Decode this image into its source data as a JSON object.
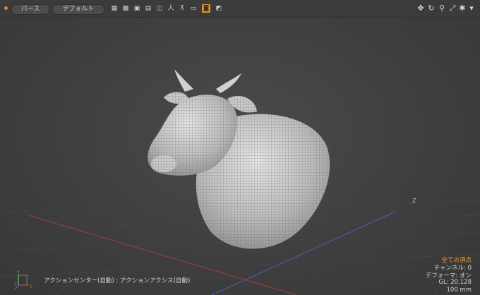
{
  "toolbar": {
    "view_mode": "パース",
    "shading": "デフォルト",
    "icons": [
      "wireframe-icon",
      "grid-icon",
      "shaded-icon",
      "texture-icon",
      "layout-icon",
      "person-icon",
      "pin-icon",
      "camera-icon",
      "drawing-style-icon"
    ],
    "nav_icons": [
      "move-icon",
      "rotate-icon",
      "zoom-icon",
      "fit-icon",
      "settings-icon",
      "dropdown-icon"
    ],
    "accent_color": "#e89a2c"
  },
  "viewport": {
    "axis_label": "Z",
    "mesh": "wireframe cow head and torso sculpt"
  },
  "status": {
    "selection": "全ての頂点",
    "channels": "チャンネル: 0",
    "deformers": "デフォーマ: オン",
    "gl": "GL: 20,128",
    "grid_size": "100 mm"
  },
  "footer": {
    "hint": "アクションセンター(自動) : アクションアクシス(自動)"
  },
  "axes_widget": {
    "x": "X",
    "y": "Y",
    "z": "Z"
  }
}
